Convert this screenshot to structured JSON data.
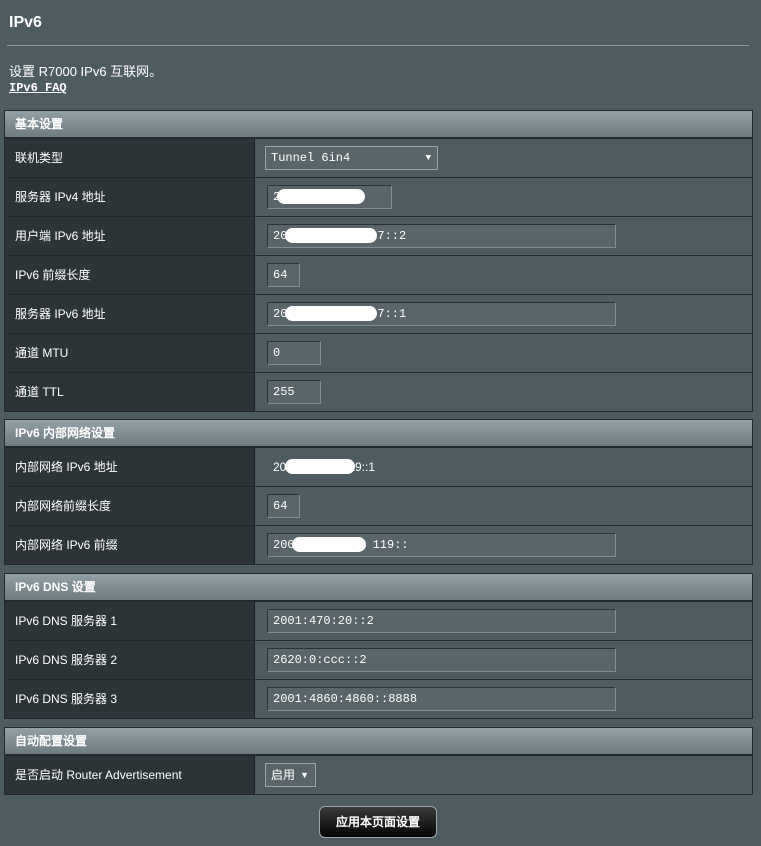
{
  "page": {
    "title": "IPv6",
    "description": "设置 R7000 IPv6 互联网。",
    "faq_link": "IPv6 FAQ"
  },
  "basic": {
    "header": "基本设置",
    "connection_type_label": "联机类型",
    "connection_type_value": "Tunnel 6in4",
    "server_ipv4_label": "服务器 IPv4 地址",
    "server_ipv4_value": "2",
    "client_ipv6_label": "用户端 IPv6 地址",
    "client_ipv6_value_prefix": "20",
    "client_ipv6_value_suffix": "7::2",
    "prefix_len_label": "IPv6 前缀长度",
    "prefix_len_value": "64",
    "server_ipv6_label": "服务器 IPv6 地址",
    "server_ipv6_value_prefix": "20",
    "server_ipv6_value_suffix": "7::1",
    "mtu_label": "通道 MTU",
    "mtu_value": "0",
    "ttl_label": "通道 TTL",
    "ttl_value": "255"
  },
  "lan": {
    "header": "IPv6 内部网络设置",
    "lan_addr_label": "内部网络 IPv6 地址",
    "lan_addr_prefix": "20",
    "lan_addr_suffix": "19::1",
    "lan_prefix_len_label": "内部网络前缀长度",
    "lan_prefix_len_value": "64",
    "lan_prefix_label": "内部网络 IPv6 前缀",
    "lan_prefix_prefix": "200",
    "lan_prefix_suffix": "119::"
  },
  "dns": {
    "header": "IPv6 DNS 设置",
    "dns1_label": "IPv6 DNS 服务器 1",
    "dns1_value": "2001:470:20::2",
    "dns2_label": "IPv6 DNS 服务器 2",
    "dns2_value": "2620:0:ccc::2",
    "dns3_label": "IPv6 DNS 服务器 3",
    "dns3_value": "2001:4860:4860::8888"
  },
  "autoconf": {
    "header": "自动配置设置",
    "ra_label": "是否启动 Router Advertisement",
    "ra_value": "启用"
  },
  "actions": {
    "apply_label": "应用本页面设置"
  }
}
